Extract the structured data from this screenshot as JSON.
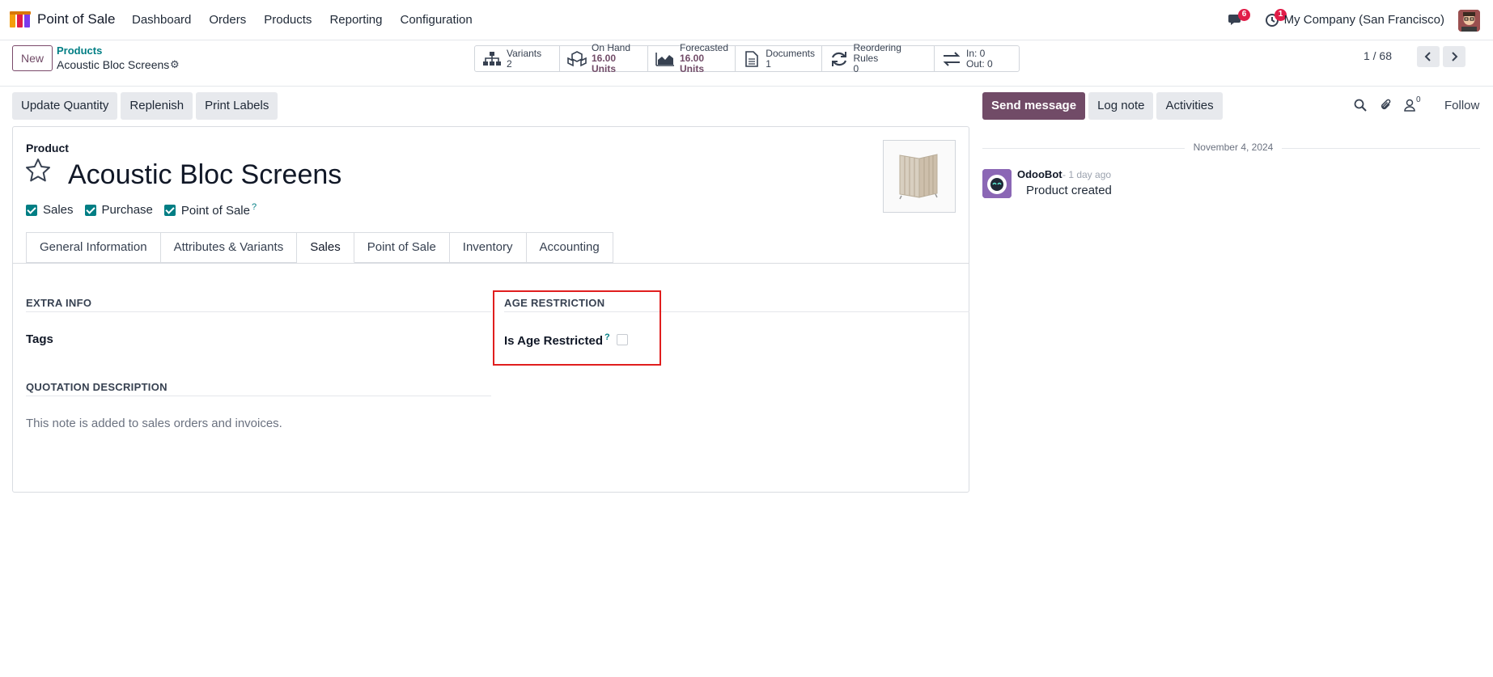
{
  "navbar": {
    "app_name": "Point of Sale",
    "menu": [
      "Dashboard",
      "Orders",
      "Products",
      "Reporting",
      "Configuration"
    ],
    "messages_badge": "6",
    "activities_badge": "1",
    "company": "My Company (San Francisco)"
  },
  "control": {
    "new_label": "New",
    "breadcrumb_parent": "Products",
    "breadcrumb_current": "Acoustic Bloc Screens",
    "stats": {
      "variants": {
        "label": "Variants",
        "value": "2"
      },
      "on_hand": {
        "label": "On Hand",
        "value": "16.00 Units"
      },
      "forecasted": {
        "label": "Forecasted",
        "value": "16.00 Units"
      },
      "documents": {
        "label": "Documents",
        "value": "1"
      },
      "reordering": {
        "label": "Reordering Rules",
        "value": "0"
      },
      "inout": {
        "in": "In: 0",
        "out": "Out: 0"
      }
    },
    "pager": "1 / 68"
  },
  "actions": {
    "update_quantity": "Update Quantity",
    "replenish": "Replenish",
    "print_labels": "Print Labels"
  },
  "form": {
    "product_label": "Product",
    "title": "Acoustic Bloc Screens",
    "checks": {
      "sales": "Sales",
      "purchase": "Purchase",
      "pos": "Point of Sale"
    },
    "help_mark": "?",
    "tabs": [
      "General Information",
      "Attributes & Variants",
      "Sales",
      "Point of Sale",
      "Inventory",
      "Accounting"
    ],
    "active_tab": "Sales",
    "extra_info": "EXTRA INFO",
    "tags_label": "Tags",
    "quotation_description": "QUOTATION DESCRIPTION",
    "quotation_placeholder": "This note is added to sales orders and invoices.",
    "age_restriction": "AGE RESTRICTION",
    "is_age_restricted": "Is Age Restricted",
    "is_age_restricted_checked": false
  },
  "chatter": {
    "send_message": "Send message",
    "log_note": "Log note",
    "activities": "Activities",
    "followers_count": "0",
    "follow": "Follow",
    "date": "November 4, 2024",
    "author": "OdooBot",
    "time": "- 1 day ago",
    "body": "Product created"
  },
  "colors": {
    "brand": "#714b67",
    "teal": "#017e84",
    "badge": "#e11d48",
    "highlight": "#e01e1e"
  }
}
